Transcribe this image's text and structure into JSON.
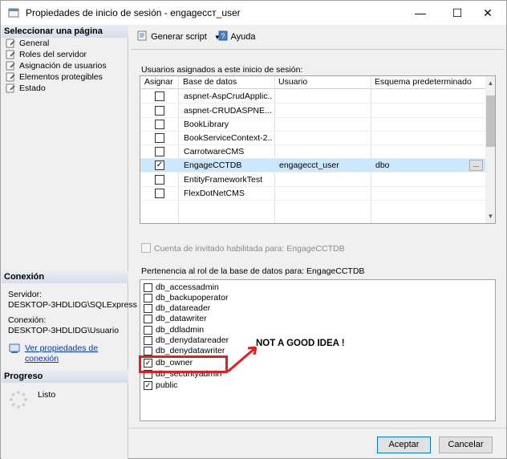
{
  "window": {
    "title": "Propiedades de inicio de sesión - engageccт_user",
    "controls": [
      "—",
      "☐",
      "✕"
    ]
  },
  "sidebar": {
    "select_page_header": "Seleccionar una página",
    "pages": [
      {
        "label": "General",
        "icon": "page-wrench-icon"
      },
      {
        "label": "Roles del servidor",
        "icon": "page-wrench-icon"
      },
      {
        "label": "Asignación de usuarios",
        "icon": "page-wrench-icon"
      },
      {
        "label": "Elementos protegibles",
        "icon": "page-wrench-icon"
      },
      {
        "label": "Estado",
        "icon": "page-wrench-icon"
      }
    ],
    "connection_header": "Conexión",
    "server_label": "Servidor:",
    "server_value": "DESKTOP-3HDLIDG\\SQLExpress",
    "connection_label": "Conexión:",
    "connection_value": "DESKTOP-3HDLIDG\\Usuario",
    "view_props_link_line1": "Ver propiedades de",
    "view_props_link_line2": "conexión",
    "progress_header": "Progreso",
    "progress_status": "Listo"
  },
  "toolbar": {
    "script_label": "Generar script",
    "help_label": "Ayuda"
  },
  "user_mapping": {
    "label": "Usuarios asignados a este inicio de sesión:",
    "columns": [
      "Asignar",
      "Base de datos",
      "Usuario",
      "Esquema predeterminado"
    ],
    "rows": [
      {
        "checked": false,
        "database": "aspnet-AspCrudApplic...",
        "user": "",
        "schema": ""
      },
      {
        "checked": false,
        "database": "aspnet-CRUDASPNE...",
        "user": "",
        "schema": ""
      },
      {
        "checked": false,
        "database": "BookLibrary",
        "user": "",
        "schema": ""
      },
      {
        "checked": false,
        "database": "BookServiceContext-2...",
        "user": "",
        "schema": ""
      },
      {
        "checked": false,
        "database": "CarrotwareCMS",
        "user": "",
        "schema": ""
      },
      {
        "checked": true,
        "database": "EngageCCTDB",
        "user": "engagecct_user",
        "schema": "dbo",
        "selected": true
      },
      {
        "checked": false,
        "database": "EntityFrameworkTest",
        "user": "",
        "schema": ""
      },
      {
        "checked": false,
        "database": "FlexDotNetCMS",
        "user": "",
        "schema": ""
      }
    ],
    "ellipsis": "..."
  },
  "guest": {
    "label": "Cuenta de invitado habilitada para: EngageCCTDB"
  },
  "roles": {
    "label": "Pertenencia al rol de la base de datos para: EngageCCTDB",
    "items": [
      {
        "name": "db_accessadmin",
        "checked": false
      },
      {
        "name": "db_backupoperator",
        "checked": false
      },
      {
        "name": "db_datareader",
        "checked": false
      },
      {
        "name": "db_datawriter",
        "checked": false
      },
      {
        "name": "db_ddladmin",
        "checked": false
      },
      {
        "name": "db_denydatareader",
        "checked": false
      },
      {
        "name": "db_denydatawriter",
        "checked": false
      },
      {
        "name": "db_owner",
        "checked": true
      },
      {
        "name": "db_securityadmin",
        "checked": false
      },
      {
        "name": "public",
        "checked": true
      }
    ]
  },
  "annotation": {
    "text": "NOT A GOOD IDEA !",
    "color": "#e02020"
  },
  "buttons": {
    "ok": "Aceptar",
    "cancel": "Cancelar"
  }
}
